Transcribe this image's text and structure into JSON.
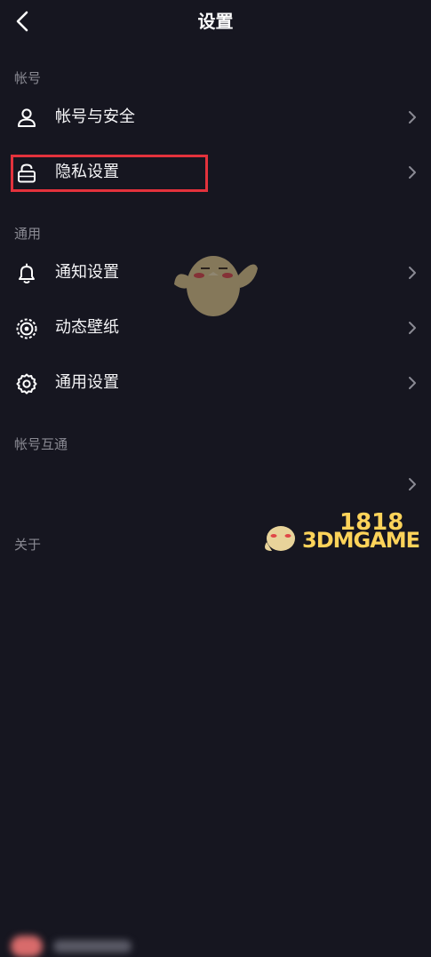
{
  "header": {
    "title": "设置"
  },
  "sections": {
    "account": "帐号",
    "general": "通用",
    "linked": "帐号互通",
    "about": "关于"
  },
  "rows": {
    "account_security": "帐号与安全",
    "privacy": "隐私设置",
    "notifications": "通知设置",
    "wallpaper": "动态壁纸",
    "general_settings": "通用设置"
  },
  "watermark": {
    "text": "3DMGAME",
    "number": "1818"
  },
  "colors": {
    "background": "#161620",
    "highlight": "#e3323c",
    "watermark": "#fcd35a"
  }
}
